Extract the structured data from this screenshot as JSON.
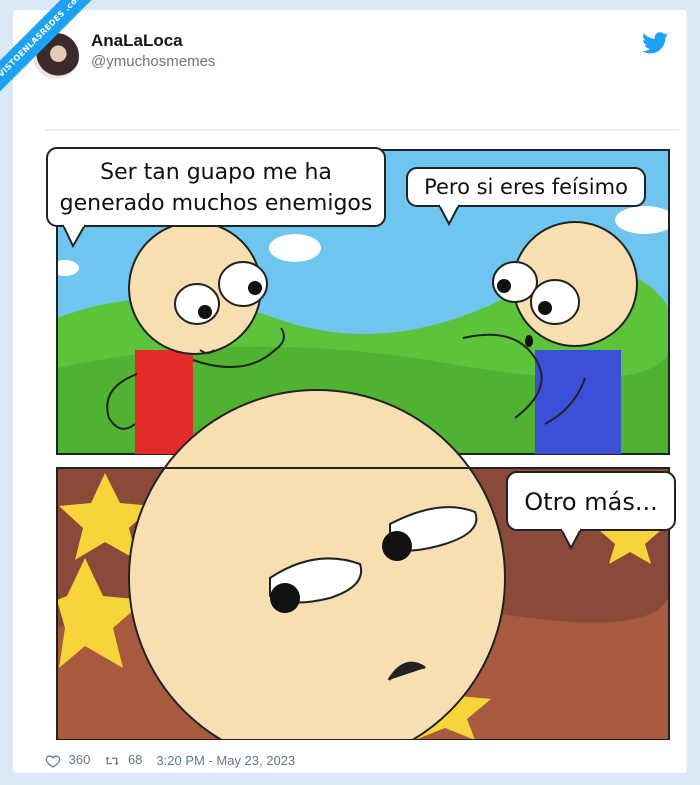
{
  "watermark": {
    "text": "VISTOENLASREDES .com"
  },
  "tweet": {
    "display_name": "AnaLaLoca",
    "handle": "@ymuchosmemes",
    "likes": "360",
    "retweets": "68",
    "timestamp": "3:20 PM - May 23, 2023"
  },
  "comic": {
    "panel1": {
      "left_bubble_line1": "Ser tan guapo me ha",
      "left_bubble_line2": "generado muchos enemigos",
      "right_bubble": "Pero si eres feísimo"
    },
    "panel2": {
      "bubble": "Otro más..."
    }
  },
  "icons": {
    "brand": "twitter-bird-icon",
    "like": "heart-icon",
    "retweet": "retweet-icon"
  },
  "colors": {
    "twitter_blue": "#1da1f2",
    "sky": "#6ec6f0",
    "grass": "#5cc43a",
    "red_shirt": "#e52a2a",
    "blue_shirt": "#3b4fd8",
    "skin": "#f7dfb1"
  }
}
